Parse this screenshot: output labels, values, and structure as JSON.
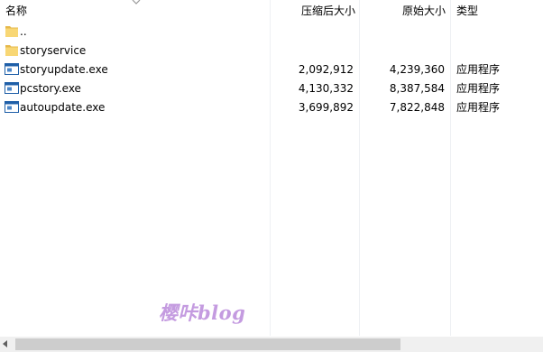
{
  "columns": {
    "name": "名称",
    "compressed": "压缩后大小",
    "original": "原始大小",
    "type": "类型"
  },
  "rows": [
    {
      "name": "..",
      "compressed": "",
      "original": "",
      "type": "",
      "icon": "folder-icon"
    },
    {
      "name": "storyservice",
      "compressed": "",
      "original": "",
      "type": "",
      "icon": "folder-icon"
    },
    {
      "name": "storyupdate.exe",
      "compressed": "2,092,912",
      "original": "4,239,360",
      "type": "应用程序",
      "icon": "application-icon"
    },
    {
      "name": "pcstory.exe",
      "compressed": "4,130,332",
      "original": "8,387,584",
      "type": "应用程序",
      "icon": "application-icon"
    },
    {
      "name": "autoupdate.exe",
      "compressed": "3,699,892",
      "original": "7,822,848",
      "type": "应用程序",
      "icon": "application-icon"
    }
  ],
  "watermark": "樱咔blog",
  "colors": {
    "folder": "#f8d775",
    "folder_dark": "#e6b84a",
    "app_blue": "#1f5fa8",
    "watermark": "#c49be0"
  }
}
